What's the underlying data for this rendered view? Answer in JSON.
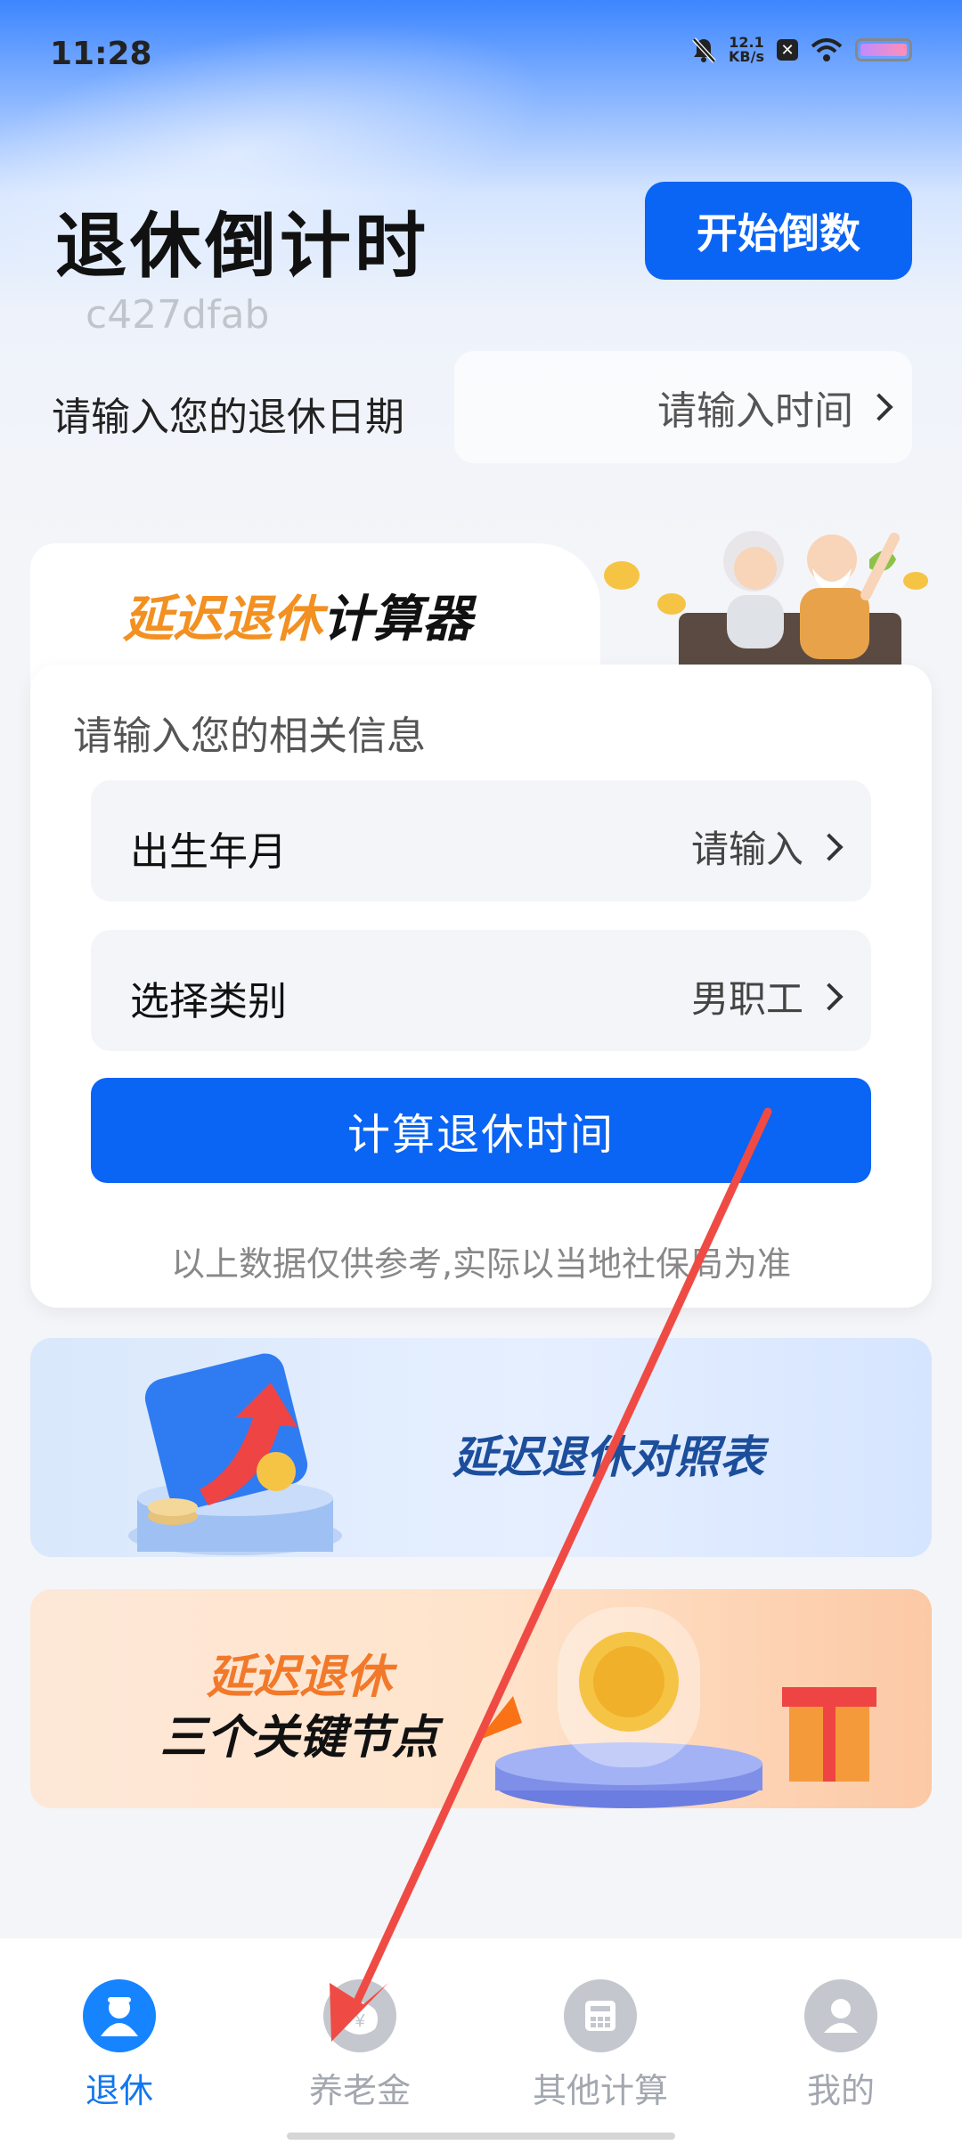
{
  "status_bar": {
    "time": "11:28",
    "net_speed_value": "12.1",
    "net_speed_unit": "KB/s",
    "icons": [
      "mute-bell-icon",
      "x-app-icon",
      "wifi-icon",
      "battery-icon"
    ]
  },
  "header": {
    "title": "退休倒计时",
    "start_button": "开始倒数",
    "watermark": "c427dfab"
  },
  "retire_date": {
    "label": "请输入您的退休日期",
    "placeholder": "请输入时间"
  },
  "calculator": {
    "tab_title_orange": "延迟退休",
    "tab_title_black": "计算器",
    "card_title": "请输入您的相关信息",
    "fields": [
      {
        "label": "出生年月",
        "value": "请输入"
      },
      {
        "label": "选择类别",
        "value": "男职工"
      }
    ],
    "button": "计算退休时间",
    "disclaimer": "以上数据仅供参考,实际以当地社保局为准"
  },
  "banners": {
    "banner1_title": "延迟退休对照表",
    "banner2_line1": "延迟退休",
    "banner2_line2": "三个关键节点"
  },
  "tabbar": {
    "items": [
      {
        "label": "退休",
        "icon": "retire-person-icon",
        "active": true
      },
      {
        "label": "养老金",
        "icon": "pension-coin-icon",
        "active": false
      },
      {
        "label": "其他计算",
        "icon": "calculator-icon",
        "active": false
      },
      {
        "label": "我的",
        "icon": "profile-icon",
        "active": false
      }
    ]
  },
  "colors": {
    "primary": "#0a64f4",
    "accent_orange": "#f29021",
    "annotation_arrow": "#ef4b44"
  }
}
